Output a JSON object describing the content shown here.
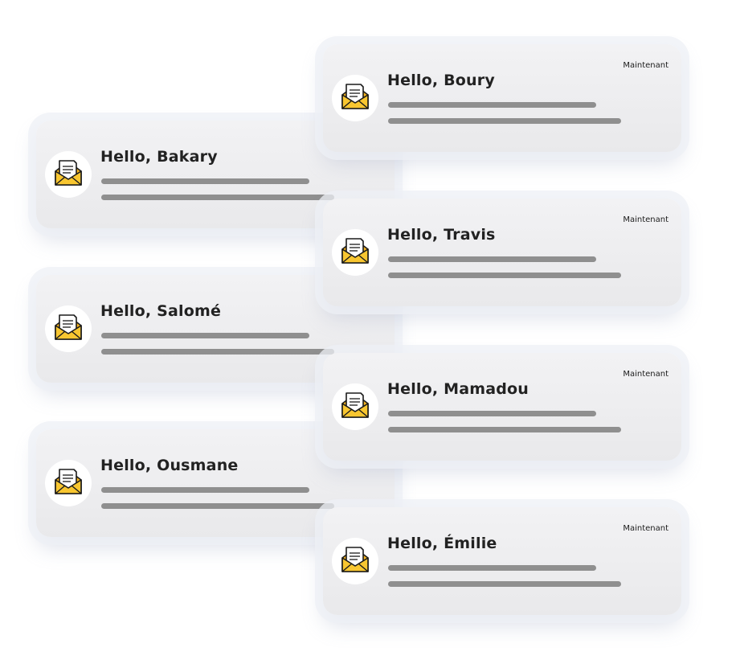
{
  "icon": "open-envelope-with-letter-icon",
  "colors": {
    "card": "#efeff1",
    "skeleton_line": "#8f8f8f",
    "envelope": "#f7c12e",
    "text": "#222222"
  },
  "notifications_left": [
    {
      "title": "Hello, Bakary"
    },
    {
      "title": "Hello, Salomé"
    },
    {
      "title": "Hello, Ousmane"
    }
  ],
  "notifications_right": [
    {
      "title": "Hello, Boury",
      "time": "Maintenant"
    },
    {
      "title": "Hello, Travis",
      "time": "Maintenant"
    },
    {
      "title": "Hello, Mamadou",
      "time": "Maintenant"
    },
    {
      "title": "Hello, Émilie",
      "time": "Maintenant"
    }
  ]
}
